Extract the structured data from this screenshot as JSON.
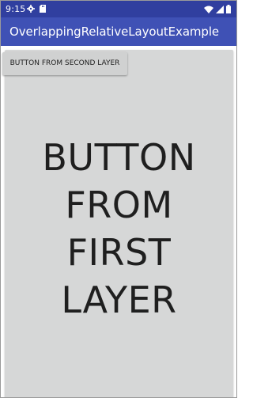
{
  "status_bar": {
    "time": "9:15",
    "left_icons": [
      "gear-icon",
      "sd-card-icon"
    ],
    "right_icons": [
      "wifi-icon",
      "signal-icon",
      "battery-icon"
    ],
    "color": "#303f9f"
  },
  "app_bar": {
    "title": "OverlappingRelativeLayoutExample",
    "color": "#3f51b5"
  },
  "first_layer_button": {
    "lines": [
      "BUTTON",
      "FROM",
      "FIRST",
      "LAYER"
    ]
  },
  "second_layer_button": {
    "label": "BUTTON FROM SECOND LAYER"
  }
}
